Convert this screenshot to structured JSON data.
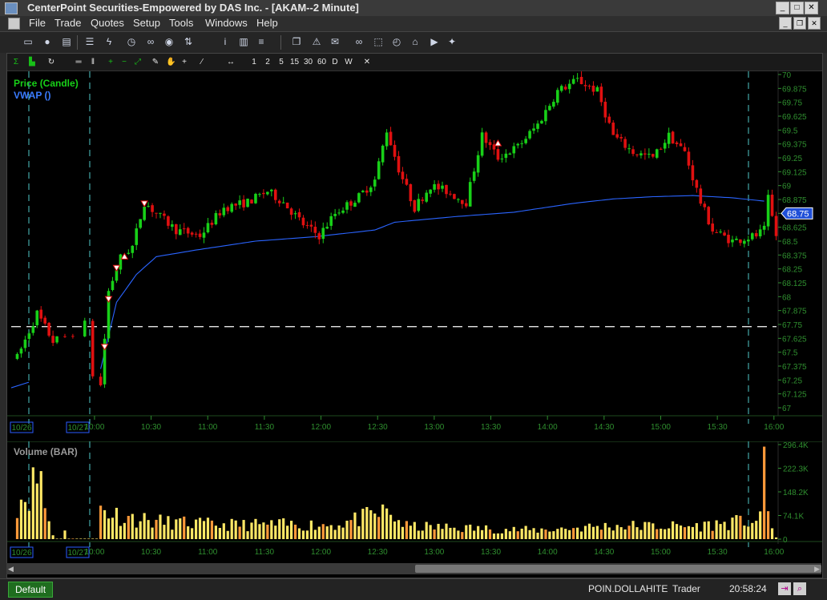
{
  "window": {
    "title": "CenterPoint Securities-Empowered by DAS Inc. - [AKAM--2 Minute]",
    "controls": [
      "_",
      "□",
      "✕"
    ]
  },
  "menu": [
    "File",
    "Trade",
    "Quotes",
    "Setup",
    "Tools",
    "Windows",
    "Help"
  ],
  "toolbar_icons": [
    "window-icon",
    "account-icon",
    "order-icon",
    "list-icon",
    "lightning-icon",
    "clock-icon",
    "link-icon",
    "eye-icon",
    "sort-icon",
    "info-icon",
    "bar-chart-icon",
    "copy-icon",
    "alert-icon",
    "mail-icon",
    "binoculars-icon",
    "select-icon",
    "timer-icon",
    "home-icon",
    "youtube-icon",
    "twitter-icon"
  ],
  "chart_toolbar": {
    "intervals": [
      "1",
      "2",
      "5",
      "15",
      "30",
      "60",
      "D",
      "W"
    ],
    "close": "✕"
  },
  "colors": {
    "up": "#18d018",
    "down": "#e01010",
    "vwap": "#2a64ff",
    "volume": "#ffe866",
    "grid": "#1e3a1e",
    "axis_text": "#2f8f2f",
    "marker": "#4fc8c8"
  },
  "chart_data": [
    {
      "type": "candlestick",
      "legend": [
        "Price (Candle)",
        "VWAP ()"
      ],
      "ylim": [
        67.0,
        70.0
      ],
      "y_ticks": [
        "70",
        "69.875",
        "69.75",
        "69.625",
        "69.5",
        "69.375",
        "69.25",
        "69.125",
        "69",
        "68.875",
        "68.75",
        "68.625",
        "68.5",
        "68.375",
        "68.25",
        "68.125",
        "68",
        "67.875",
        "67.75",
        "67.625",
        "67.5",
        "67.375",
        "67.25",
        "67.125",
        "67"
      ],
      "x_ticks": [
        "10:00",
        "10:30",
        "11:00",
        "11:30",
        "12:00",
        "12:30",
        "13:00",
        "13:30",
        "14:00",
        "14:30",
        "15:00",
        "15:30",
        "16:00"
      ],
      "date_labels": [
        "10/26",
        "10/27"
      ],
      "last_price": "68.75",
      "reference_line": 67.73,
      "anchors": [
        [
          0,
          67.45
        ],
        [
          5,
          67.85
        ],
        [
          9,
          67.6
        ],
        [
          13,
          67.65
        ],
        [
          17,
          67.75
        ],
        [
          19,
          67.3
        ],
        [
          21,
          67.2
        ],
        [
          23,
          68.05
        ],
        [
          26,
          68.35
        ],
        [
          29,
          68.45
        ],
        [
          32,
          68.85
        ],
        [
          35,
          68.75
        ],
        [
          40,
          68.6
        ],
        [
          46,
          68.55
        ],
        [
          52,
          68.8
        ],
        [
          58,
          68.85
        ],
        [
          63,
          68.95
        ],
        [
          67,
          68.85
        ],
        [
          72,
          68.65
        ],
        [
          76,
          68.55
        ],
        [
          80,
          68.75
        ],
        [
          86,
          68.9
        ],
        [
          90,
          69.05
        ],
        [
          93,
          69.5
        ],
        [
          96,
          69.15
        ],
        [
          100,
          68.8
        ],
        [
          104,
          69.0
        ],
        [
          108,
          68.95
        ],
        [
          113,
          68.85
        ],
        [
          117,
          69.45
        ],
        [
          121,
          69.25
        ],
        [
          126,
          69.35
        ],
        [
          131,
          69.55
        ],
        [
          136,
          69.85
        ],
        [
          141,
          69.95
        ],
        [
          146,
          69.85
        ],
        [
          150,
          69.45
        ],
        [
          155,
          69.3
        ],
        [
          160,
          69.25
        ],
        [
          164,
          69.45
        ],
        [
          168,
          69.3
        ],
        [
          172,
          68.85
        ],
        [
          175,
          68.6
        ],
        [
          180,
          68.5
        ],
        [
          186,
          68.55
        ],
        [
          188,
          68.6
        ],
        [
          189,
          68.88
        ],
        [
          191,
          68.55
        ]
      ],
      "vwap_anchors": [
        [
          21,
          67.35
        ],
        [
          25,
          67.95
        ],
        [
          30,
          68.2
        ],
        [
          35,
          68.36
        ],
        [
          45,
          68.42
        ],
        [
          60,
          68.5
        ],
        [
          75,
          68.54
        ],
        [
          90,
          68.6
        ],
        [
          95,
          68.67
        ],
        [
          110,
          68.72
        ],
        [
          125,
          68.76
        ],
        [
          140,
          68.84
        ],
        [
          150,
          68.88
        ],
        [
          160,
          68.9
        ],
        [
          170,
          68.91
        ],
        [
          180,
          68.89
        ],
        [
          188,
          68.86
        ]
      ]
    },
    {
      "type": "bar",
      "legend": [
        "Volume (BAR)"
      ],
      "ylim": [
        0,
        296400
      ],
      "y_ticks": [
        "296.4K",
        "222.3K",
        "148.2K",
        "74.1K",
        "0"
      ],
      "x_ticks": [
        "10:00",
        "10:30",
        "11:00",
        "11:30",
        "12:00",
        "12:30",
        "13:00",
        "13:30",
        "14:00",
        "14:30",
        "15:00",
        "15:30",
        "16:00"
      ],
      "date_labels": [
        "10/26",
        "10/27"
      ],
      "profile": [
        [
          0,
          120
        ],
        [
          3,
          150
        ],
        [
          6,
          210
        ],
        [
          7,
          100
        ],
        [
          9,
          15
        ],
        [
          12,
          40
        ],
        [
          14,
          5
        ],
        [
          21,
          100
        ],
        [
          23,
          85
        ],
        [
          27,
          70
        ],
        [
          35,
          55
        ],
        [
          50,
          45
        ],
        [
          80,
          45
        ],
        [
          93,
          85
        ],
        [
          98,
          40
        ],
        [
          130,
          28
        ],
        [
          150,
          42
        ],
        [
          170,
          40
        ],
        [
          183,
          55
        ],
        [
          187,
          60
        ],
        [
          188,
          290
        ],
        [
          189,
          90
        ],
        [
          191,
          5
        ]
      ]
    }
  ],
  "status": {
    "tab": "Default",
    "user": "POIN.DOLLAHITE",
    "role": "Trader",
    "time": "20:58:24"
  }
}
